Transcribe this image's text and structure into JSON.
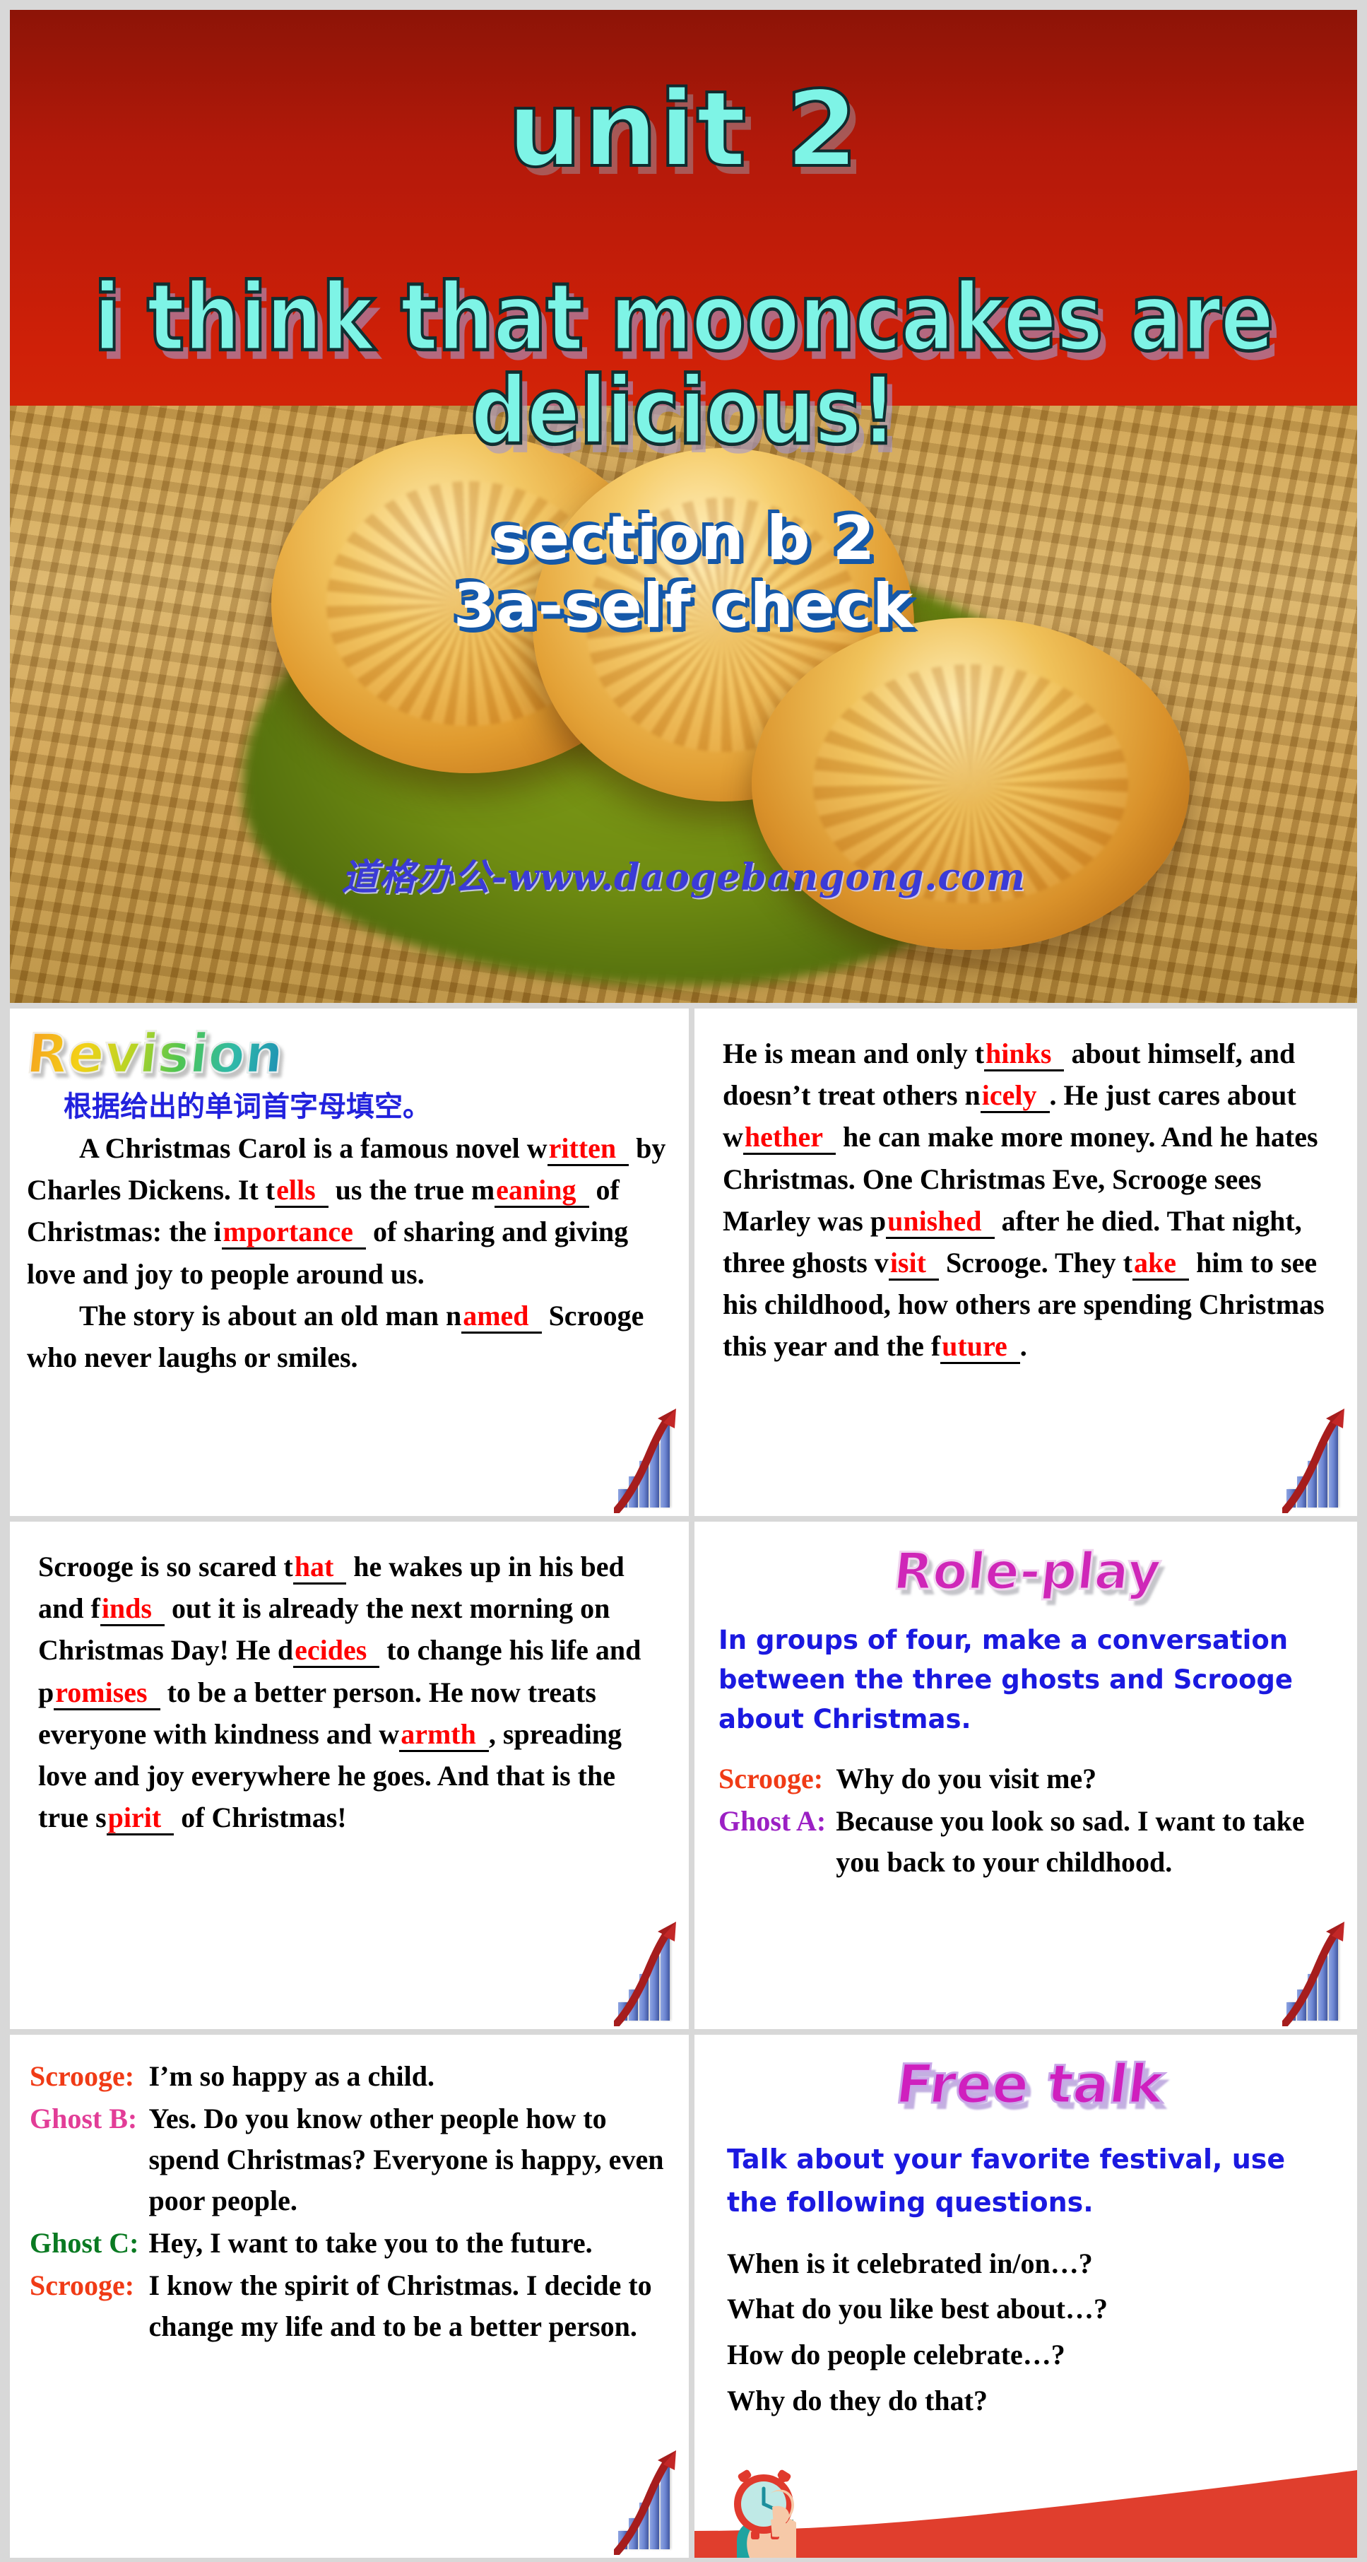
{
  "hero": {
    "title": "unit 2",
    "subtitle": "i think that mooncakes are delicious!",
    "section_line1": "section b 2",
    "section_line2": "3a-self check",
    "watermark": "道格办公-www.daogebangong.com",
    "colors": {
      "title_fill": "#7EF4E6",
      "section_shadow": "#1558a8",
      "background_red": "#cf2008"
    }
  },
  "panels": {
    "revision": {
      "title": "Revision",
      "instruction_cn": "根据给出的单词首字母填空。",
      "paragraph1": {
        "seg1": "A Christmas Carol is a famous novel w",
        "blank1": "ritten",
        "seg2": " by Charles Dickens. It t",
        "blank2": "ells",
        "seg3": " us the true m",
        "blank3": "eaning",
        "seg4": " of Christmas: the i",
        "blank4": "mportance",
        "seg5": " of sharing and giving love and joy to people around us."
      },
      "paragraph2": {
        "seg1": "The story is about an old man n",
        "blank1": "amed",
        "seg2": " Scrooge who never laughs or smiles."
      }
    },
    "passage2": {
      "seg1": "He is mean and only t",
      "blank1": "hinks",
      "seg2": " about himself, and doesn’t treat others n",
      "blank2": "icely",
      "seg3": ". He just cares about w",
      "blank3": "hether",
      "seg4": " he can make more money. And he hates Christmas. One Christmas Eve, Scrooge sees Marley was p",
      "blank4": "unished",
      "seg5": " after he died. That night, three ghosts v",
      "blank5": "isit",
      "seg6": " Scrooge. They t",
      "blank6": "ake",
      "seg7": " him to see his childhood, how others are spending Christmas this year and the f",
      "blank7": "uture",
      "seg8": "."
    },
    "passage3": {
      "seg1": "Scrooge is so scared t",
      "blank1": "hat",
      "seg2": " he wakes up in his bed and f",
      "blank2": "inds",
      "seg3": " out it is already the next morning on Christmas Day! He d",
      "blank3": "ecides",
      "seg4": " to change his life and p",
      "blank4": "romises",
      "seg5": " to be a better person. He now treats everyone with kindness and w",
      "blank5": "armth",
      "seg6": ", spreading love and joy everywhere he goes. And that is the true s",
      "blank6": "pirit",
      "seg7": " of Christmas!"
    },
    "role_play": {
      "title": "Role-play",
      "instruction": "In groups of four, make a conversation between the three ghosts and Scrooge about Christmas.",
      "dialogue": [
        {
          "speaker": "Scrooge:",
          "speaker_color": "#f03b16",
          "line": "Why do you visit me?"
        },
        {
          "speaker": "Ghost A:",
          "speaker_color": "#9b20c4",
          "line": "Because you look so sad. I want to take you back to your childhood."
        }
      ]
    },
    "dialogue_continued": {
      "dialogue": [
        {
          "speaker": "Scrooge:",
          "speaker_color": "#f03b16",
          "line": "I’m so happy as a child."
        },
        {
          "speaker": "Ghost B:",
          "speaker_color": "#e23d97",
          "line": "Yes. Do you know other people how to spend Christmas? Everyone is happy, even poor people."
        },
        {
          "speaker": "Ghost C:",
          "speaker_color": "#0a7a22",
          "line": "Hey, I want to take you to the future."
        },
        {
          "speaker": "Scrooge:",
          "speaker_color": "#f03b16",
          "line": "I know the spirit of Christmas. I decide to change my life and to be a better person."
        }
      ]
    },
    "free_talk": {
      "title": "Free talk",
      "instruction": "Talk about your favorite festival, use the following questions.",
      "questions": [
        "When is it celebrated in/on…?",
        "What do you like best about…?",
        "How do people celebrate…?",
        "Why do they do that?"
      ]
    }
  },
  "decorations": {
    "chart_icon": "rising-bar-chart-icon",
    "clock_icon": "hand-holding-alarm-clock-icon",
    "swoosh_color": "#e03e2d"
  }
}
